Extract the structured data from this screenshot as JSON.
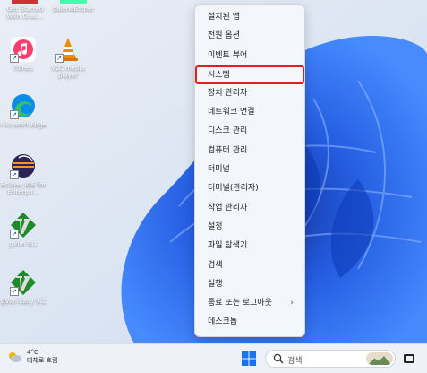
{
  "desktop_icons": [
    {
      "name": "getstarted",
      "label": "Get Started With Orac..."
    },
    {
      "name": "balenaetcher",
      "label": "balenaEtcher"
    },
    {
      "name": "itunes",
      "label": "iTunes"
    },
    {
      "name": "vlc",
      "label": "VLC media player"
    },
    {
      "name": "edge",
      "label": "Microsoft Edge"
    },
    {
      "name": "eclipse",
      "label": "Eclipse IDE for Enterpri..."
    },
    {
      "name": "gvim",
      "label": "gVim 9.1"
    },
    {
      "name": "gvimeasy",
      "label": "gVim Easy 9.1"
    }
  ],
  "context_menu": {
    "items": [
      {
        "label": "설치된 앱"
      },
      {
        "label": "전원 옵션"
      },
      {
        "label": "이벤트 뷰어"
      },
      {
        "label": "시스템",
        "highlighted": true
      },
      {
        "label": "장치 관리자"
      },
      {
        "label": "네트워크 연결"
      },
      {
        "label": "디스크 관리"
      },
      {
        "label": "컴퓨터 관리"
      },
      {
        "label": "터미널"
      },
      {
        "label": "터미널(관리자)"
      },
      {
        "label": "작업 관리자"
      },
      {
        "label": "설정"
      },
      {
        "label": "파일 탐색기"
      },
      {
        "label": "검색"
      },
      {
        "label": "실행"
      },
      {
        "label": "종료 또는 로그아웃",
        "submenu_arrow": "›"
      },
      {
        "label": "데스크톱"
      }
    ],
    "highlight_color": "#e02020"
  },
  "taskbar": {
    "weather_temp": "4°C",
    "weather_desc": "대체로 흐림",
    "search_placeholder": "검색"
  }
}
